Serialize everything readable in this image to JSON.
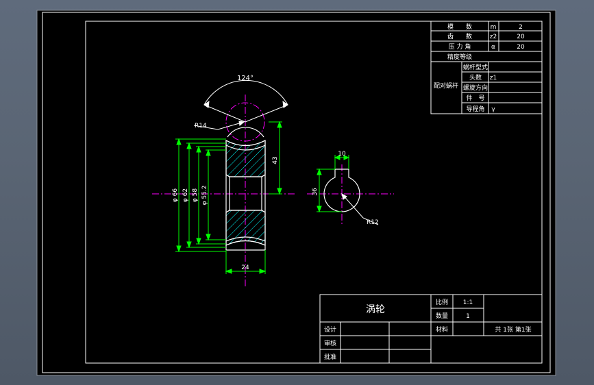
{
  "colors": {
    "background": "#5f6b7c",
    "paper": "#000000",
    "frame": "#ffffff",
    "outline": "#ffffff",
    "dimension": "#00ff00",
    "centerline": "#ff00ff",
    "hatch": "#00ffff",
    "leader": "#ffffff"
  },
  "params_table": {
    "rows": [
      {
        "name": "模　　数",
        "symbol": "m",
        "value": "2"
      },
      {
        "name": "齿　　数",
        "symbol": "z2",
        "value": "20"
      },
      {
        "name": "压 力 角",
        "symbol": "α",
        "value": "20"
      },
      {
        "name": "精度等级",
        "symbol": "",
        "value": ""
      }
    ],
    "mating_label": "配对蜗杆",
    "mating_rows": [
      {
        "name": "蜗杆型式",
        "value": ""
      },
      {
        "name": "头数",
        "value": "z1"
      },
      {
        "name": "螺旋方向",
        "value": ""
      },
      {
        "name": "件　号",
        "value": ""
      },
      {
        "name": "导程角",
        "value": "γ"
      }
    ]
  },
  "drawing": {
    "angle": "124°",
    "radius_top": "R14",
    "dim_height": "43",
    "dim_width": "24",
    "diameters": [
      "φ 66",
      "φ 62",
      "φ 58",
      "φ 55.2"
    ],
    "keyway_width": "10",
    "keyway_height": "36",
    "radius_bore": "R12"
  },
  "title_block": {
    "part_name": "涡轮",
    "scale_label": "比例",
    "scale_value": "1:1",
    "qty_label": "数量",
    "qty_value": "1",
    "material_label": "材料",
    "sheet_info": "共 1张 第1张",
    "design_label": "设计",
    "check_label": "审核",
    "approve_label": "批准"
  }
}
